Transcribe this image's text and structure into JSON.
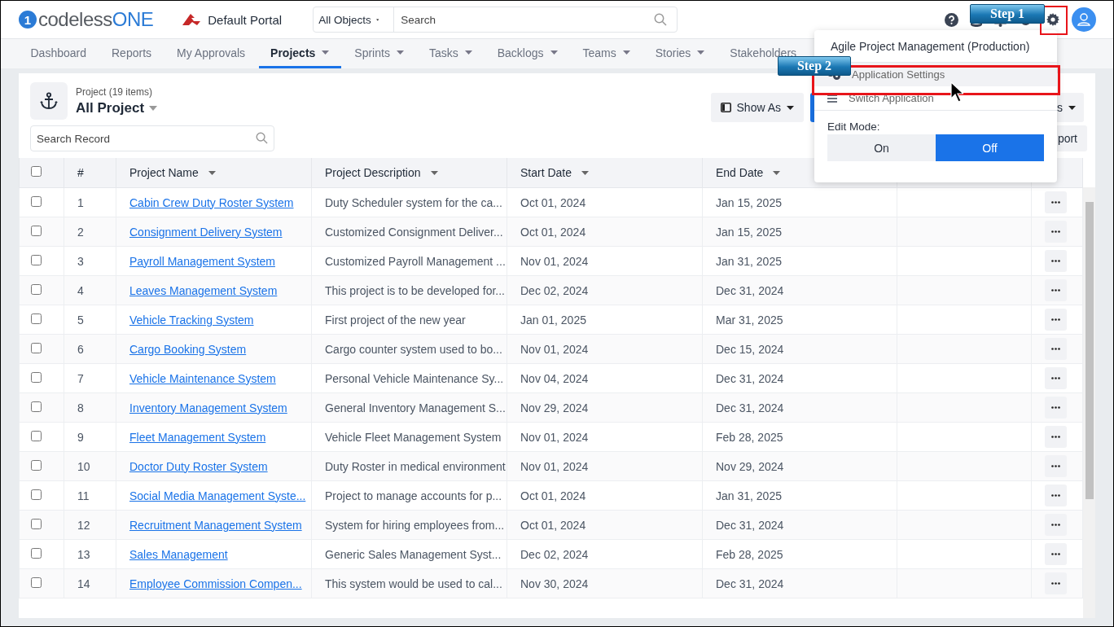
{
  "header": {
    "logo": {
      "mark": "1",
      "prefix": "codeless",
      "suffix": "ONE"
    },
    "portal": "Default Portal",
    "search": {
      "scope": "All Objects",
      "placeholder": "Search"
    }
  },
  "nav": [
    {
      "label": "Dashboard",
      "selected": false,
      "dropdown": false
    },
    {
      "label": "Reports",
      "selected": false,
      "dropdown": false
    },
    {
      "label": "My Approvals",
      "selected": false,
      "dropdown": false
    },
    {
      "label": "Projects",
      "selected": true,
      "dropdown": true
    },
    {
      "label": "Sprints",
      "selected": false,
      "dropdown": true
    },
    {
      "label": "Tasks",
      "selected": false,
      "dropdown": true
    },
    {
      "label": "Backlogs",
      "selected": false,
      "dropdown": true
    },
    {
      "label": "Teams",
      "selected": false,
      "dropdown": true
    },
    {
      "label": "Stories",
      "selected": false,
      "dropdown": true
    },
    {
      "label": "Stakeholders",
      "selected": false,
      "dropdown": false
    }
  ],
  "list": {
    "subtitle": "Project (19 items)",
    "title": "All Project",
    "search_placeholder": "Search Record",
    "buttons": [
      {
        "kind": "show_as",
        "label": "Show As"
      },
      {
        "kind": "primary"
      },
      {
        "kind": "menu",
        "label": "s"
      }
    ],
    "export_label": "port"
  },
  "table": {
    "all_selected": false,
    "columns": [
      {
        "label": "#",
        "sortable": false
      },
      {
        "label": "Project Name",
        "sortable": true
      },
      {
        "label": "Project Description",
        "sortable": true
      },
      {
        "label": "Start Date",
        "sortable": true
      },
      {
        "label": "End Date",
        "sortable": true
      }
    ],
    "rows": [
      {
        "selected": false,
        "number": "1",
        "name": "Cabin Crew Duty Roster System",
        "description": "Duty Scheduler system for the ca...",
        "start": "Oct 01, 2024",
        "end": "Jan 15, 2025"
      },
      {
        "selected": false,
        "number": "2",
        "name": "Consignment Delivery System",
        "description": "Customized Consignment Deliver...",
        "start": "Oct 01, 2024",
        "end": "Jan 15, 2025"
      },
      {
        "selected": false,
        "number": "3",
        "name": "Payroll Management System",
        "description": "Customized Payroll Management ...",
        "start": "Nov 01, 2024",
        "end": "Jan 31, 2025"
      },
      {
        "selected": false,
        "number": "4",
        "name": "Leaves Management System",
        "description": "This project is to be developed for...",
        "start": "Dec 02, 2024",
        "end": "Dec 31, 2024"
      },
      {
        "selected": false,
        "number": "5",
        "name": "Vehicle Tracking System",
        "description": "First project of the new year",
        "start": "Jan 01, 2025",
        "end": "Mar 31, 2025"
      },
      {
        "selected": false,
        "number": "6",
        "name": "Cargo Booking System",
        "description": "Cargo counter system used to bo...",
        "start": "Nov 01, 2024",
        "end": "Dec 15, 2024"
      },
      {
        "selected": false,
        "number": "7",
        "name": "Vehicle Maintenance System",
        "description": "Personal Vehicle Maintenance Sy...",
        "start": "Nov 04, 2024",
        "end": "Dec 31, 2024"
      },
      {
        "selected": false,
        "number": "8",
        "name": "Inventory Management System",
        "description": "General Inventory Management S...",
        "start": "Nov 29, 2024",
        "end": "Dec 31, 2024"
      },
      {
        "selected": false,
        "number": "9",
        "name": "Fleet Management System",
        "description": "Vehicle Fleet Management System",
        "start": "Nov 01, 2024",
        "end": "Feb 28, 2025"
      },
      {
        "selected": false,
        "number": "10",
        "name": "Doctor Duty Roster System",
        "description": "Duty Roster in medical environment",
        "start": "Nov 01, 2024",
        "end": "Nov 29, 2024"
      },
      {
        "selected": false,
        "number": "11",
        "name": "Social Media Management Syste...",
        "description": "Project to manage accounts for p...",
        "start": "Oct 01, 2024",
        "end": "Jan 31, 2025"
      },
      {
        "selected": false,
        "number": "12",
        "name": "Recruitment Management System",
        "description": "System for hiring employees from...",
        "start": "Oct 01, 2024",
        "end": "Dec 31, 2024"
      },
      {
        "selected": false,
        "number": "13",
        "name": "Sales Management",
        "description": "Generic Sales Management Syst...",
        "start": "Dec 02, 2024",
        "end": "Feb 28, 2025"
      },
      {
        "selected": false,
        "number": "14",
        "name": "Employee Commission Compen...",
        "description": "This system would be used to cal...",
        "start": "Nov 30, 2024",
        "end": "Dec 31, 2024"
      }
    ]
  },
  "menu": {
    "title": "Agile Project Management (Production)",
    "items": [
      {
        "kind": "settings",
        "label": "Application Settings",
        "highlighted": true
      },
      {
        "kind": "switch",
        "label": "Switch Application",
        "highlighted": false
      }
    ],
    "edit_mode": {
      "label": "Edit Mode:",
      "options": [
        {
          "label": "On",
          "selected": false
        },
        {
          "label": "Off",
          "selected": true
        }
      ]
    }
  },
  "annotations": [
    {
      "label": "Step 1"
    },
    {
      "label": "Step 2"
    }
  ]
}
